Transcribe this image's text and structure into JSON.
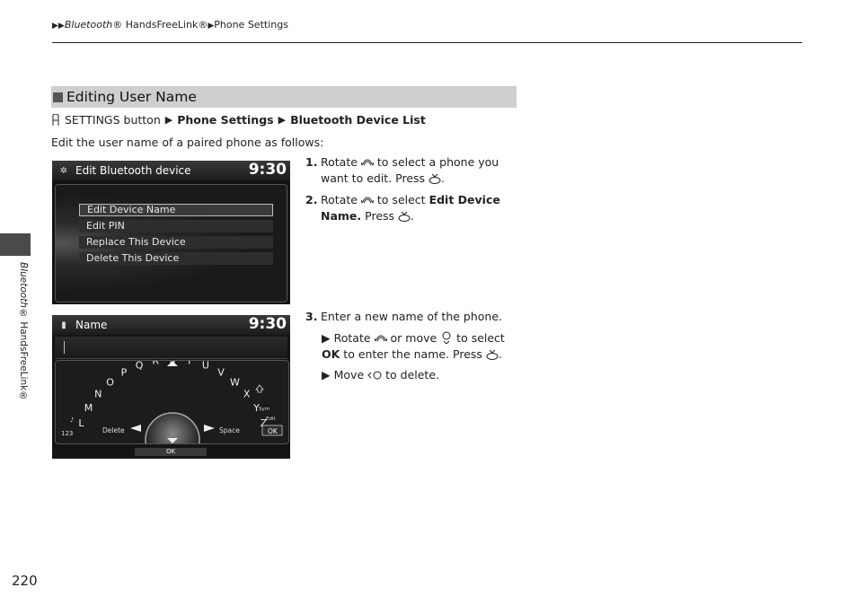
{
  "breadcrumb": {
    "item1": "Bluetooth",
    "item1_suffix": "® HandsFreeLink®",
    "item2": "Phone Settings"
  },
  "sidebar": {
    "label_italic": "Bluetooth",
    "label_rest": "® HandsFreeLink®"
  },
  "page_number": "220",
  "section": {
    "title": "Editing User Name",
    "path": {
      "button": "SETTINGS button",
      "step1": "Phone Settings",
      "step2": "Bluetooth Device List"
    },
    "intro": "Edit the user name of a paired phone as follows:"
  },
  "steps": [
    {
      "num": "1.",
      "text_a": "Rotate",
      "text_b": "to select a phone you want to edit. Press",
      "text_c": "."
    },
    {
      "num": "2.",
      "text_a": "Rotate",
      "text_b": "to select",
      "bold": "Edit Device Name.",
      "text_c": "Press",
      "text_d": "."
    },
    {
      "num": "3.",
      "text": "Enter a new name of the phone."
    }
  ],
  "substeps": [
    {
      "a": "Rotate",
      "b": "or move",
      "c": "to select",
      "bold": "OK",
      "d": "to enter the name. Press",
      "e": "."
    },
    {
      "a": "Move",
      "b": "to delete."
    }
  ],
  "screen1": {
    "header": "Edit Bluetooth device",
    "clock": "9:30",
    "items": [
      "Edit Device Name",
      "Edit PIN",
      "Replace This Device",
      "Delete This Device"
    ]
  },
  "screen2": {
    "header": "Name",
    "clock": "9:30",
    "letters": [
      "L",
      "M",
      "N",
      "O",
      "P",
      "Q",
      "R",
      "S",
      "T",
      "U",
      "V",
      "W",
      "X",
      "Y",
      "Z"
    ],
    "labels": {
      "num": "123",
      "delete": "Delete",
      "space": "Space",
      "sym": "Sym",
      "edit": "Edit",
      "ok_btn": "OK",
      "ok_bar": "OK"
    }
  }
}
